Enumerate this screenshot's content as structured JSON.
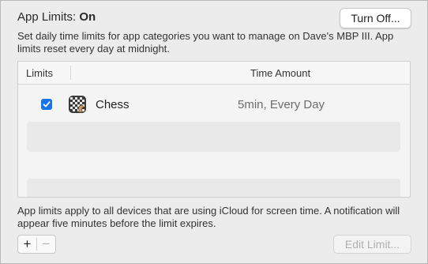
{
  "header": {
    "title_prefix": "App Limits: ",
    "status": "On",
    "turn_off_label": "Turn Off..."
  },
  "description": "Set daily time limits for app categories you want to manage on Dave's MBP III. App limits reset every day at midnight.",
  "table": {
    "columns": [
      "Limits",
      "Time Amount"
    ],
    "rows": [
      {
        "checked": true,
        "app_icon": "chess-icon",
        "app_name": "Chess",
        "time_amount": "5min, Every Day"
      }
    ]
  },
  "footer": {
    "note": "App limits apply to all devices that are using iCloud for screen time. A notification will appear five minutes before the limit expires.",
    "add_label": "+",
    "remove_label": "−",
    "edit_limit_label": "Edit Limit..."
  },
  "colors": {
    "checkbox_accent": "#1a73e8",
    "disabled_text": "#b0b0b0"
  }
}
